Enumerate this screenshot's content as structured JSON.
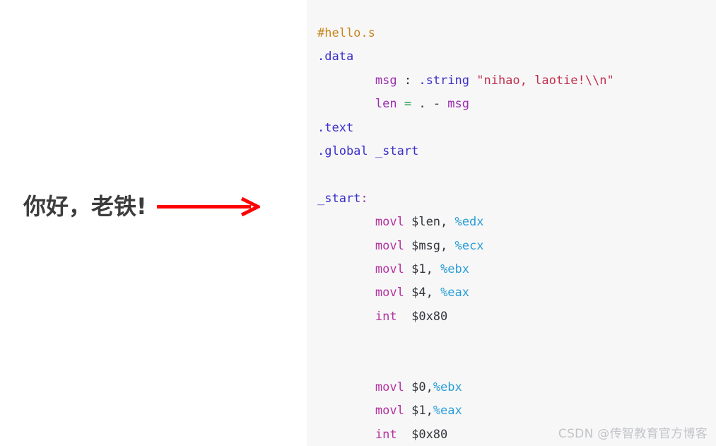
{
  "annotation": {
    "text": "你好，老铁!",
    "text_color": "#3c3c3c",
    "arrow": {
      "name": "right-arrow",
      "color": "#ff0000"
    }
  },
  "code_panel": {
    "background": "#f7f7f8",
    "language": "assembly",
    "lines": [
      {
        "id": "line-1",
        "tokens": [
          {
            "text": "#hello.s",
            "type": "comment"
          }
        ]
      },
      {
        "id": "line-2",
        "tokens": [
          {
            "text": ".data",
            "type": "dir"
          }
        ]
      },
      {
        "id": "line-3",
        "tokens": [
          {
            "text": "        ",
            "type": "punct"
          },
          {
            "text": "msg",
            "type": "sym"
          },
          {
            "text": " : ",
            "type": "punct"
          },
          {
            "text": ".string",
            "type": "dir"
          },
          {
            "text": " ",
            "type": "punct"
          },
          {
            "text": "\"nihao, laotie!\\\\n\"",
            "type": "string"
          }
        ]
      },
      {
        "id": "line-4",
        "tokens": [
          {
            "text": "        ",
            "type": "punct"
          },
          {
            "text": "len",
            "type": "sym"
          },
          {
            "text": " ",
            "type": "punct"
          },
          {
            "text": "=",
            "type": "op"
          },
          {
            "text": " . - ",
            "type": "punct"
          },
          {
            "text": "msg",
            "type": "sym"
          }
        ]
      },
      {
        "id": "line-5",
        "tokens": [
          {
            "text": ".text",
            "type": "dir"
          }
        ]
      },
      {
        "id": "line-6",
        "tokens": [
          {
            "text": ".global",
            "type": "dir"
          },
          {
            "text": " ",
            "type": "punct"
          },
          {
            "text": "_start",
            "type": "label"
          }
        ]
      },
      {
        "id": "line-7",
        "tokens": []
      },
      {
        "id": "line-8",
        "tokens": [
          {
            "text": "_start",
            "type": "label"
          },
          {
            "text": ":",
            "type": "sym"
          }
        ]
      },
      {
        "id": "line-9",
        "tokens": [
          {
            "text": "        ",
            "type": "punct"
          },
          {
            "text": "movl",
            "type": "mn"
          },
          {
            "text": " ",
            "type": "punct"
          },
          {
            "text": "$len,",
            "type": "imm"
          },
          {
            "text": " ",
            "type": "punct"
          },
          {
            "text": "%edx",
            "type": "reg"
          }
        ]
      },
      {
        "id": "line-10",
        "tokens": [
          {
            "text": "        ",
            "type": "punct"
          },
          {
            "text": "movl",
            "type": "mn"
          },
          {
            "text": " ",
            "type": "punct"
          },
          {
            "text": "$msg,",
            "type": "imm"
          },
          {
            "text": " ",
            "type": "punct"
          },
          {
            "text": "%ecx",
            "type": "reg"
          }
        ]
      },
      {
        "id": "line-11",
        "tokens": [
          {
            "text": "        ",
            "type": "punct"
          },
          {
            "text": "movl",
            "type": "mn"
          },
          {
            "text": " ",
            "type": "punct"
          },
          {
            "text": "$1,",
            "type": "imm"
          },
          {
            "text": " ",
            "type": "punct"
          },
          {
            "text": "%ebx",
            "type": "reg"
          }
        ]
      },
      {
        "id": "line-12",
        "tokens": [
          {
            "text": "        ",
            "type": "punct"
          },
          {
            "text": "movl",
            "type": "mn"
          },
          {
            "text": " ",
            "type": "punct"
          },
          {
            "text": "$4,",
            "type": "imm"
          },
          {
            "text": " ",
            "type": "punct"
          },
          {
            "text": "%eax",
            "type": "reg"
          }
        ]
      },
      {
        "id": "line-13",
        "tokens": [
          {
            "text": "        ",
            "type": "punct"
          },
          {
            "text": "int",
            "type": "mn"
          },
          {
            "text": "  ",
            "type": "punct"
          },
          {
            "text": "$0x80",
            "type": "imm"
          }
        ]
      },
      {
        "id": "line-14",
        "tokens": []
      },
      {
        "id": "line-15",
        "tokens": []
      },
      {
        "id": "line-16",
        "tokens": [
          {
            "text": "        ",
            "type": "punct"
          },
          {
            "text": "movl",
            "type": "mn"
          },
          {
            "text": " ",
            "type": "punct"
          },
          {
            "text": "$0,",
            "type": "imm"
          },
          {
            "text": "%ebx",
            "type": "reg"
          }
        ]
      },
      {
        "id": "line-17",
        "tokens": [
          {
            "text": "        ",
            "type": "punct"
          },
          {
            "text": "movl",
            "type": "mn"
          },
          {
            "text": " ",
            "type": "punct"
          },
          {
            "text": "$1,",
            "type": "imm"
          },
          {
            "text": "%eax",
            "type": "reg"
          }
        ]
      },
      {
        "id": "line-18",
        "tokens": [
          {
            "text": "        ",
            "type": "punct"
          },
          {
            "text": "int",
            "type": "mn"
          },
          {
            "text": "  ",
            "type": "punct"
          },
          {
            "text": "$0x80",
            "type": "imm"
          }
        ]
      }
    ]
  },
  "watermark": {
    "text": "CSDN @传智教育官方博客",
    "color": "#c3c5c8"
  }
}
